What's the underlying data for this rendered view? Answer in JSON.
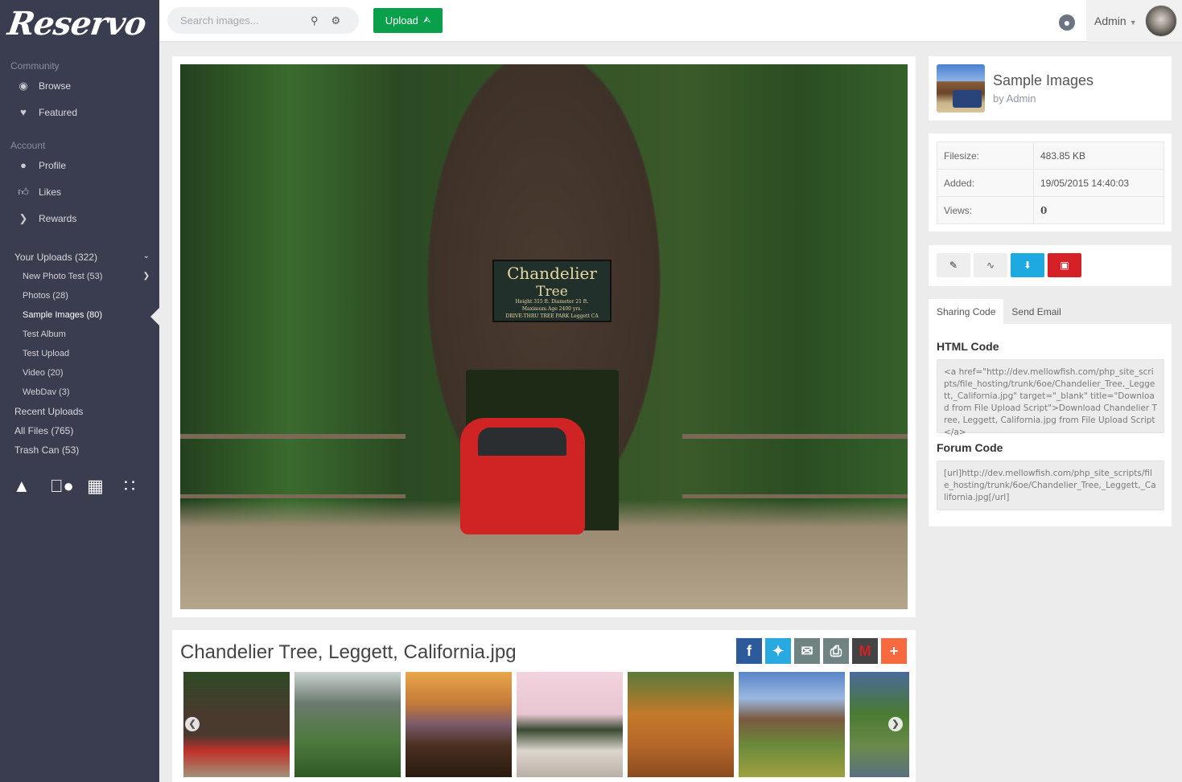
{
  "app": {
    "logo": "Reservo"
  },
  "sidebar": {
    "community_label": "Community",
    "community": [
      {
        "label": "Browse",
        "icon": "camera-icon"
      },
      {
        "label": "Featured",
        "icon": "heart-icon"
      }
    ],
    "account_label": "Account",
    "account": [
      {
        "label": "Profile",
        "icon": "user-icon"
      },
      {
        "label": "Likes",
        "icon": "thumbs-up-icon"
      },
      {
        "label": "Rewards",
        "icon": "chevron-right-icon"
      }
    ],
    "uploads": {
      "label": "Your Uploads (322)"
    },
    "albums": [
      {
        "label": "New Photo Test (53)",
        "has_children": true
      },
      {
        "label": "Photos (28)"
      },
      {
        "label": "Sample Images (80)",
        "active": true
      },
      {
        "label": "Test Album"
      },
      {
        "label": "Test Upload"
      },
      {
        "label": "Video (20)"
      },
      {
        "label": "WebDav (3)"
      }
    ],
    "links": [
      {
        "label": "Recent Uploads"
      },
      {
        "label": "All Files (765)"
      },
      {
        "label": "Trash Can (53)"
      }
    ],
    "platforms": [
      "android-icon",
      "apple-icon",
      "windows-icon",
      "blackberry-icon"
    ]
  },
  "topbar": {
    "search_placeholder": "Search images...",
    "upload_label": "Upload",
    "user_label": "Admin"
  },
  "image": {
    "sign_line1": "Chandelier",
    "sign_line2": "Tree",
    "sign_line3": "Height 315 ft.  Diameter 21 ft.",
    "sign_line4": "Maximum Age 2400 yrs.",
    "sign_line5": "DRIVE-THRU TREE PARK   Leggett CA"
  },
  "file": {
    "title": "Chandelier Tree, Leggett, California.jpg",
    "share_buttons": [
      {
        "name": "facebook",
        "glyph": "f",
        "color": "#2d5b9a"
      },
      {
        "name": "twitter",
        "glyph": "t",
        "color": "#28a9e0"
      },
      {
        "name": "email",
        "glyph": "✉",
        "color": "#6f8383"
      },
      {
        "name": "print",
        "glyph": "⎙",
        "color": "#6f8383"
      },
      {
        "name": "gmail",
        "glyph": "M",
        "color": "#444444"
      },
      {
        "name": "more",
        "glyph": "+",
        "color": "#f76a3f"
      }
    ],
    "thumbnails": [
      "Chandelier Tree",
      "Redwoods with rhododendron",
      "Sunset over fog hills",
      "Coit Tower San Francisco",
      "Autumn foliage",
      "Fort Ross chapel",
      "Oak tree by creek"
    ]
  },
  "album": {
    "title": "Sample Images",
    "by_prefix": "by",
    "owner": "Admin"
  },
  "details": [
    {
      "label": "Filesize:",
      "value": "483.85 KB"
    },
    {
      "label": "Added:",
      "value": "19/05/2015 14:40:03"
    },
    {
      "label": "Views:",
      "value": "0"
    }
  ],
  "actions": [
    {
      "name": "edit",
      "icon": "pencil-icon",
      "color": "#eeeeee"
    },
    {
      "name": "stats",
      "icon": "chart-icon",
      "color": "#eeeeee"
    },
    {
      "name": "download",
      "icon": "download-icon",
      "color": "#1fa9e1"
    },
    {
      "name": "delete",
      "icon": "trash-icon",
      "color": "#d42127"
    }
  ],
  "tabs": [
    {
      "label": "Sharing Code",
      "active": true
    },
    {
      "label": "Send Email"
    }
  ],
  "sharing": {
    "html_heading": "HTML Code",
    "html_code": "<a href=\"http://dev.mellowfish.com/php_site_scripts/file_hosting/trunk/6oe/Chandelier_Tree,_Leggett,_California.jpg\" target=\"_blank\" title=\"Download from File Upload Script\">Download Chandelier Tree, Leggett, California.jpg from File Upload Script</a>",
    "forum_heading": "Forum Code",
    "forum_code": "[url]http://dev.mellowfish.com/php_site_scripts/file_hosting/trunk/6oe/Chandelier_Tree,_Leggett,_California.jpg[/url]"
  }
}
